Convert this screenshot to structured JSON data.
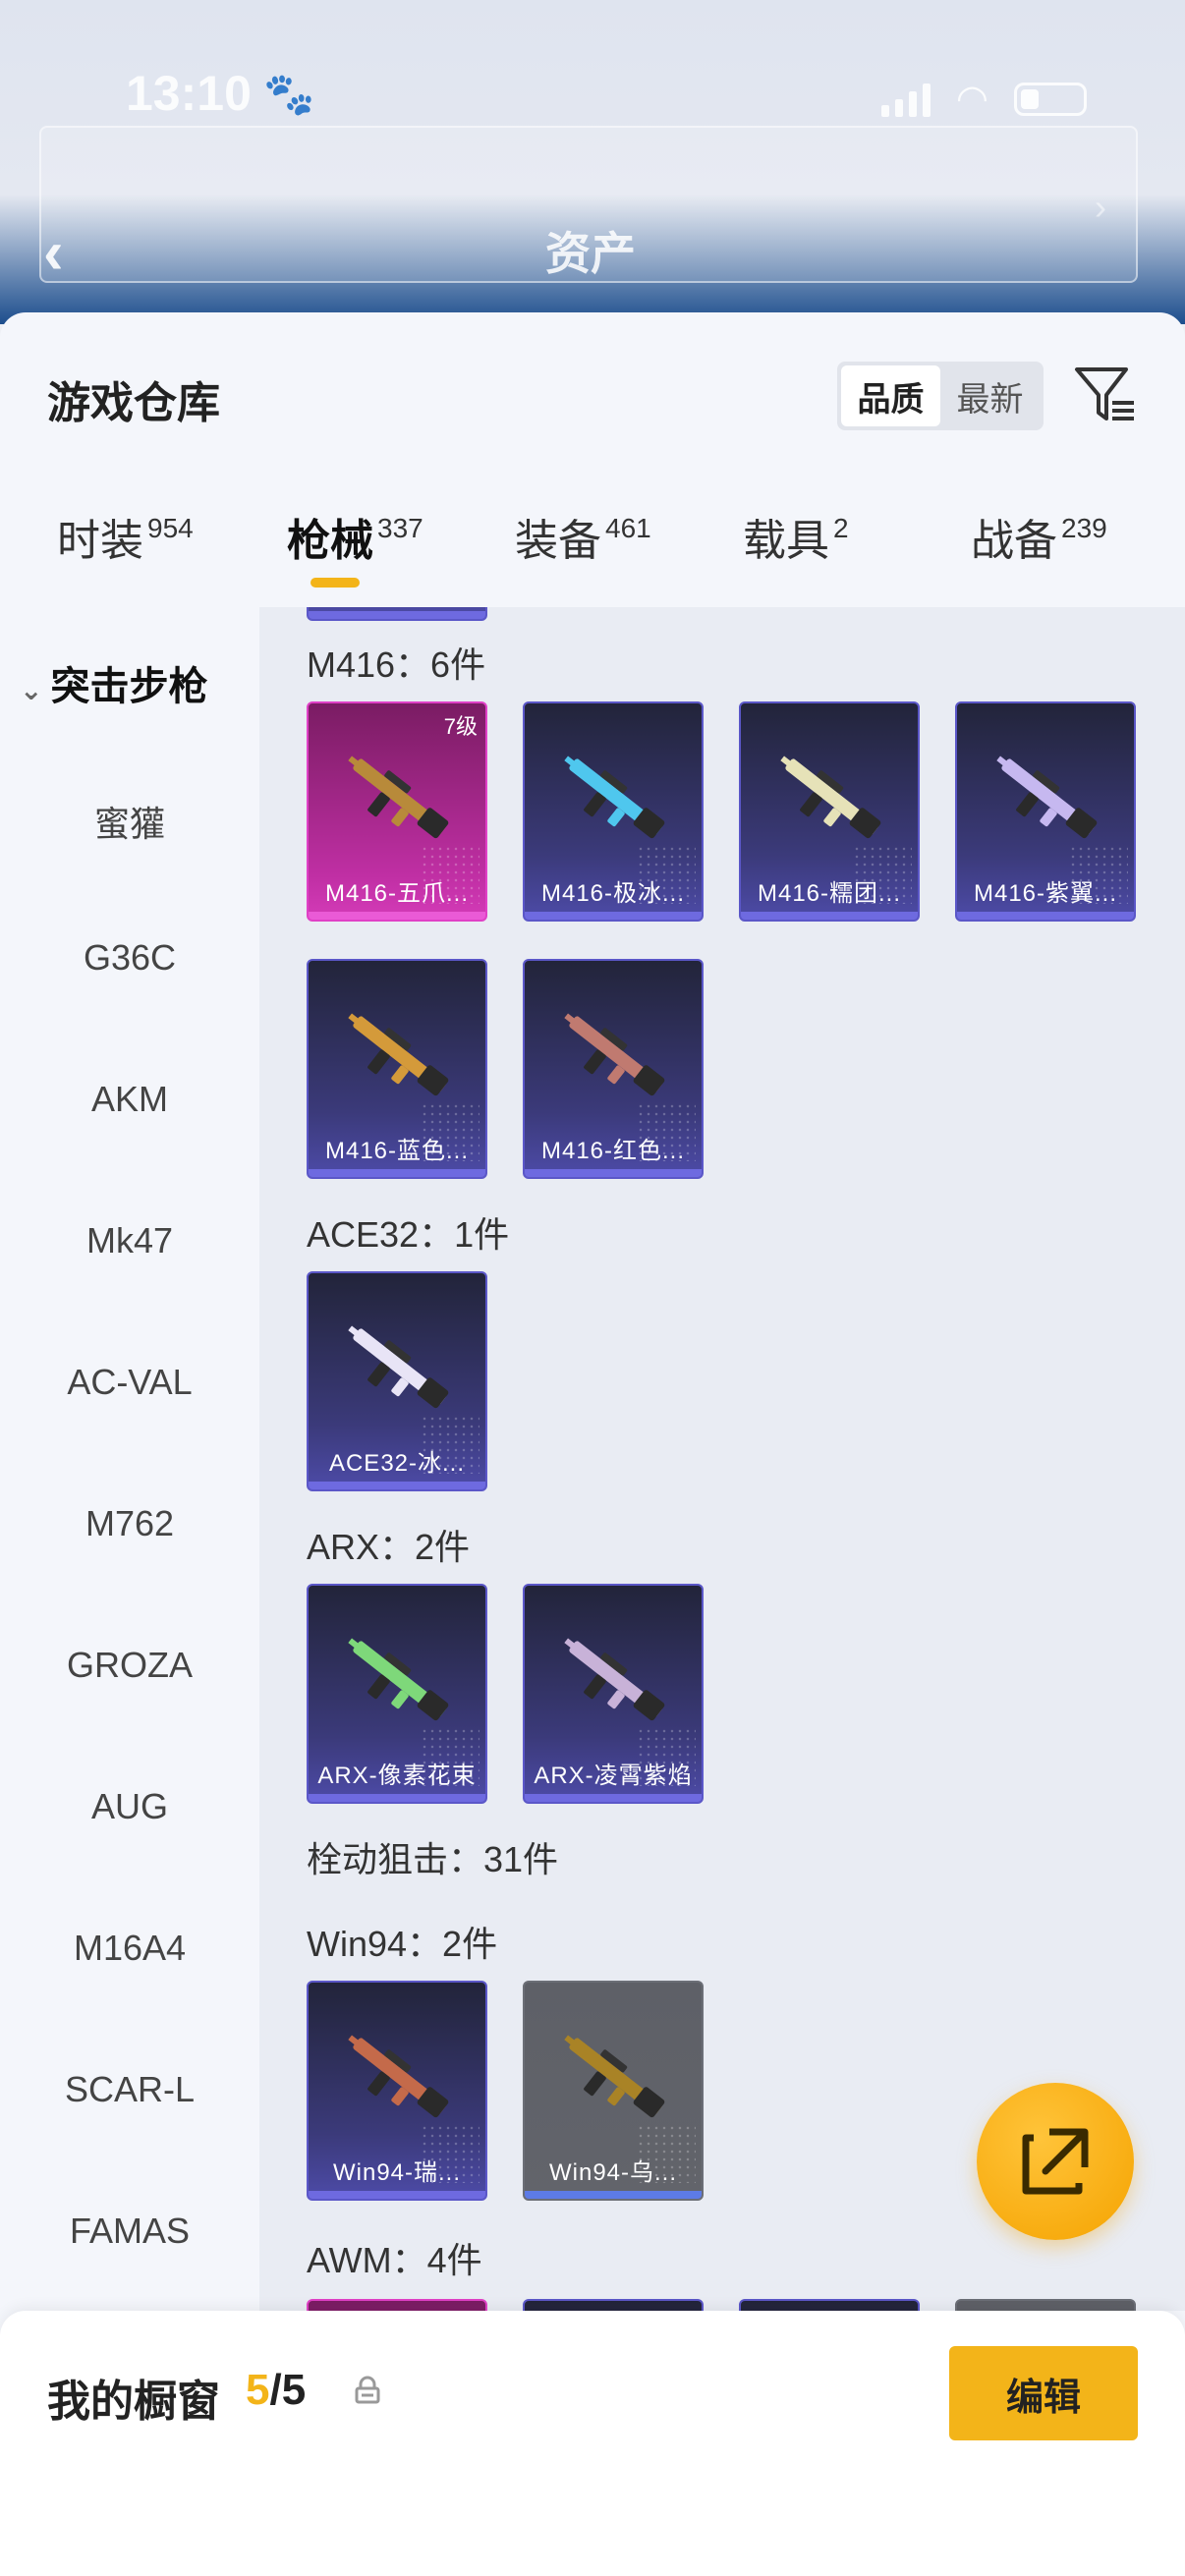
{
  "background": {
    "status_time": "13:10",
    "page_title": "资产"
  },
  "sheet": {
    "title": "游戏仓库",
    "sort": [
      "品质",
      "最新"
    ],
    "active_sort": "品质"
  },
  "tabs": [
    {
      "label": "时装",
      "count": "954"
    },
    {
      "label": "枪械",
      "count": "337"
    },
    {
      "label": "装备",
      "count": "461"
    },
    {
      "label": "载具",
      "count": "2"
    },
    {
      "label": "战备",
      "count": "239"
    }
  ],
  "active_tab": "枪械",
  "sidebar": {
    "header": "突击步枪",
    "items": [
      "蜜獾",
      "G36C",
      "AKM",
      "Mk47",
      "AC-VAL",
      "M762",
      "GROZA",
      "AUG",
      "M16A4",
      "SCAR-L",
      "FAMAS"
    ]
  },
  "groups": [
    {
      "title": "M416：6件",
      "items": [
        {
          "name": "M416-五爪...",
          "level": "7级",
          "rarity": "pink",
          "color": "#b88a3a"
        },
        {
          "name": "M416-极冰...",
          "rarity": "purple",
          "color": "#4fc7ee"
        },
        {
          "name": "M416-糯团...",
          "rarity": "purple",
          "color": "#e6e2b8"
        },
        {
          "name": "M416-紫翼...",
          "rarity": "purple",
          "color": "#c6b8f0"
        },
        {
          "name": "M416-蓝色...",
          "rarity": "purple",
          "color": "#d49a3a"
        },
        {
          "name": "M416-红色...",
          "rarity": "purple",
          "color": "#c07a70"
        }
      ]
    },
    {
      "title": "ACE32：1件",
      "items": [
        {
          "name": "ACE32-冰...",
          "rarity": "purple",
          "color": "#e8e4f6"
        }
      ]
    },
    {
      "title": "ARX：2件",
      "items": [
        {
          "name": "ARX-像素花束",
          "rarity": "purple",
          "color": "#7ed87a"
        },
        {
          "name": "ARX-凌霄紫焰",
          "rarity": "purple",
          "color": "#c8b2d8"
        }
      ]
    },
    {
      "title": "栓动狙击：31件",
      "items": []
    },
    {
      "title": "Win94：2件",
      "items": [
        {
          "name": "Win94-瑞...",
          "rarity": "purple",
          "color": "#c46a4a"
        },
        {
          "name": "Win94-乌...",
          "rarity": "gray",
          "color": "#a98326"
        }
      ]
    },
    {
      "title": "AWM：4件",
      "items": []
    }
  ],
  "bottom": {
    "label": "我的橱窗",
    "current": "5",
    "total": "/5",
    "edit_label": "编辑"
  },
  "colors": {
    "accent": "#f3b419",
    "purple_card": "#3b3a7a",
    "pink_card": "#c02fa4"
  }
}
